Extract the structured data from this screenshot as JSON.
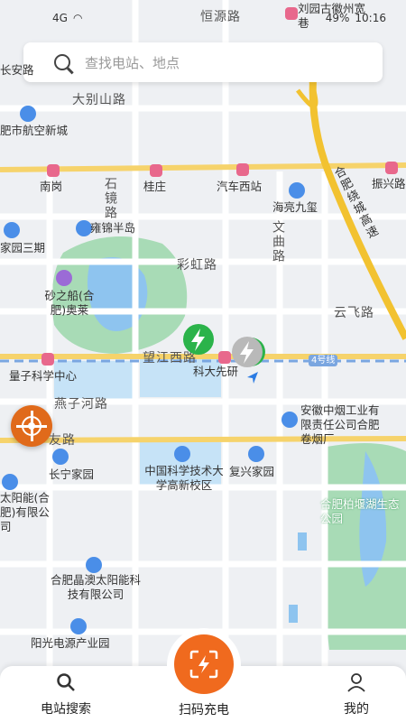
{
  "status_bar": {
    "network": "4G",
    "battery": "49%",
    "time": "10:16"
  },
  "search": {
    "placeholder": "查找电站、地点"
  },
  "map": {
    "roads": [
      "恒源路",
      "大别山路",
      "石镜路",
      "彩虹路",
      "望江西路",
      "燕子河路",
      "友路",
      "文曲路",
      "云飞路",
      "合肥绕城高速"
    ],
    "places": [
      "刘园古徽州宽巷",
      "长安路",
      "肥市航空新城",
      "南岗",
      "桂庄",
      "汽车西站",
      "海亮九玺",
      "振兴路",
      "家园三期",
      "雍锦半岛",
      "砂之船(合肥)奥莱",
      "量子科学中心",
      "科大先研",
      "4号线",
      "安徽中烟工业有限责任公司合肥卷烟厂",
      "长宁家园",
      "太阳能(合肥)有限公司",
      "中国科学技术大学高新校区",
      "复兴家园",
      "合肥柏堰湖生态公园",
      "合肥晶澳太阳能科技有限公司",
      "阳光电源产业园"
    ]
  },
  "tabs": [
    {
      "label": "电站搜索",
      "icon": "search-icon"
    },
    {
      "label": "扫码充电",
      "icon": "scan-charge-icon"
    },
    {
      "label": "我的",
      "icon": "user-icon"
    }
  ],
  "colors": {
    "accent": "#f06a1e",
    "charger_green": "#2bb34a",
    "highway": "#f2c230"
  }
}
